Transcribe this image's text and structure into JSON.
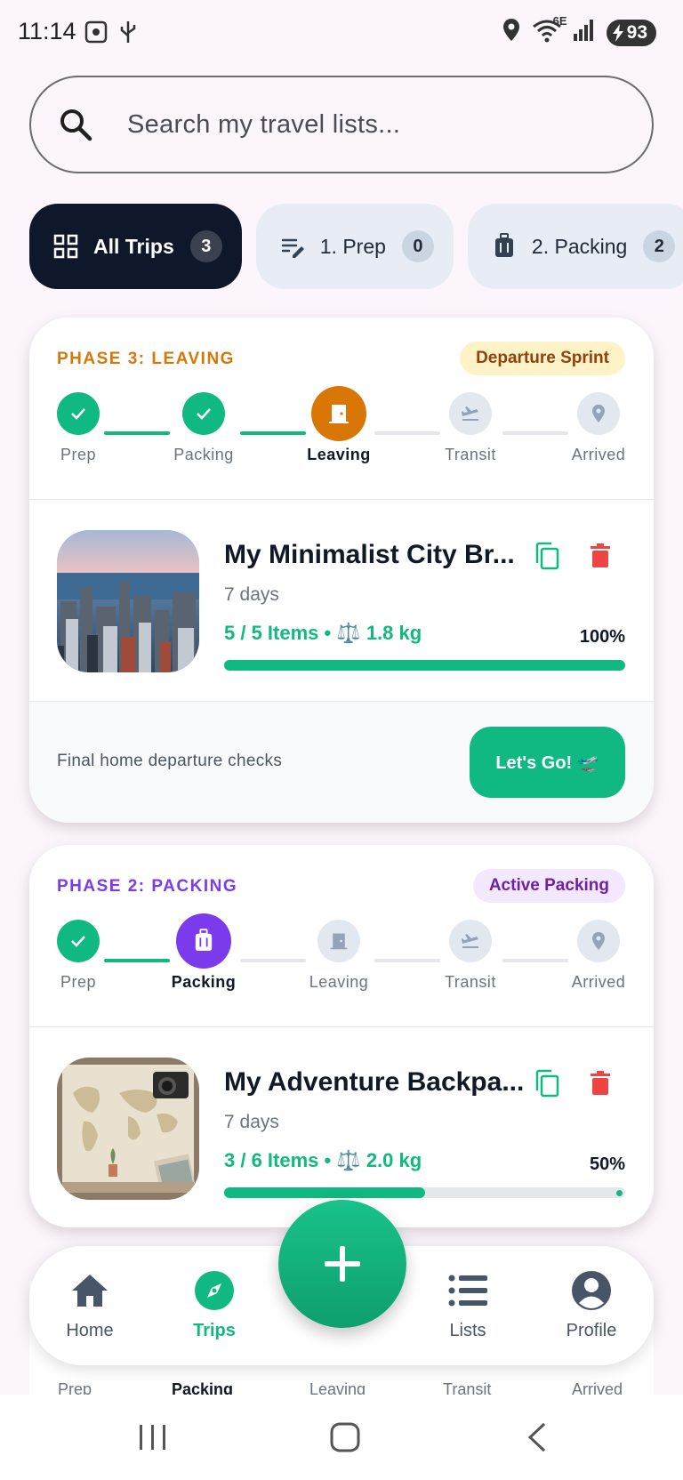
{
  "status": {
    "time": "11:14",
    "network": "6E",
    "battery": "93",
    "icons": [
      "screenshot-icon",
      "usb-icon",
      "location-icon",
      "wifi-icon",
      "signal-icon",
      "battery-icon"
    ]
  },
  "search": {
    "placeholder": "Search my travel lists..."
  },
  "filters": [
    {
      "label": "All Trips",
      "count": "3",
      "icon": "grid-icon",
      "active": true
    },
    {
      "label": "1. Prep",
      "count": "0",
      "icon": "edit-list-icon",
      "active": false
    },
    {
      "label": "2. Packing",
      "count": "2",
      "icon": "luggage-icon",
      "active": false
    }
  ],
  "colors": {
    "accent": "#10b981",
    "leaving": "#d97706",
    "packing": "#7c3aed",
    "danger": "#ef4444",
    "dark": "#0f172a"
  },
  "trips": [
    {
      "phase": "PHASE 3: LEAVING",
      "badge": "Departure Sprint",
      "steps": [
        "Prep",
        "Packing",
        "Leaving",
        "Transit",
        "Arrived"
      ],
      "current_step": 2,
      "name": "My Minimalist City Br...",
      "days": "7 days",
      "items": "5 / 5 Items • ⚖️ 1.8 kg",
      "percent": "100%",
      "progress": 1.0,
      "footer_text": "Final home departure checks",
      "action_label": "Let's Go! 🛫",
      "image": "city-skyline-photo"
    },
    {
      "phase": "PHASE 2: PACKING",
      "badge": "Active Packing",
      "steps": [
        "Prep",
        "Packing",
        "Leaving",
        "Transit",
        "Arrived"
      ],
      "current_step": 1,
      "name": "My Adventure Backpa...",
      "days": "7 days",
      "items": "3 / 6 Items • ⚖️ 2.0 kg",
      "percent": "50%",
      "progress": 0.5,
      "image": "world-map-camera-photo"
    }
  ],
  "peek_steps": [
    "Prep",
    "Packing",
    "Leaving",
    "Transit",
    "Arrived"
  ],
  "nav": [
    {
      "label": "Home",
      "icon": "home-icon"
    },
    {
      "label": "Trips",
      "icon": "compass-icon",
      "active": true
    },
    {
      "label": "Lists",
      "icon": "list-icon"
    },
    {
      "label": "Profile",
      "icon": "profile-icon"
    }
  ]
}
